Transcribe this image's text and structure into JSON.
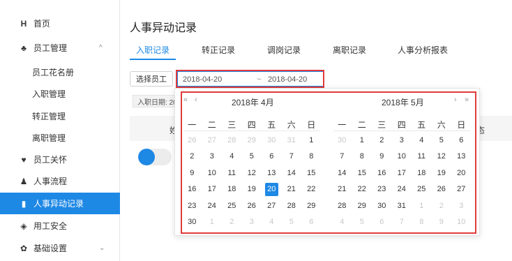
{
  "sidebar": {
    "items": [
      {
        "icon": "home-icon",
        "label": "首页",
        "glyph": "H"
      },
      {
        "icon": "users-icon",
        "label": "员工管理",
        "glyph": "♣",
        "arrow": "^"
      },
      {
        "label": "员工花名册"
      },
      {
        "label": "入职管理"
      },
      {
        "label": "转正管理"
      },
      {
        "label": "离职管理"
      },
      {
        "icon": "heart-icon",
        "label": "员工关怀",
        "glyph": "♥"
      },
      {
        "icon": "user-icon",
        "label": "人事流程",
        "glyph": "♟"
      },
      {
        "icon": "document-icon",
        "label": "人事异动记录",
        "glyph": "▮"
      },
      {
        "icon": "shield-icon",
        "label": "用工安全",
        "glyph": "◈"
      },
      {
        "icon": "gear-icon",
        "label": "基础设置",
        "glyph": "✿",
        "arrow": "⌄"
      }
    ]
  },
  "page": {
    "title": "人事异动记录"
  },
  "tabs": [
    "入职记录",
    "转正记录",
    "调岗记录",
    "离职记录",
    "人事分析报表"
  ],
  "filters": {
    "select_employee": "选择员工",
    "start_date": "2018-04-20",
    "separator": "~",
    "end_date": "2018-04-20",
    "entry_tag": "入职日期: 20"
  },
  "table": {
    "col_name": "姓",
    "col_right": "态"
  },
  "calendar": {
    "nav_prev_year": "«",
    "nav_prev_month": "‹",
    "nav_next_month": "›",
    "nav_next_year": "»",
    "weekdays": [
      "一",
      "二",
      "三",
      "四",
      "五",
      "六",
      "日"
    ],
    "left": {
      "title": "2018年 4月",
      "days": [
        [
          "26",
          "m"
        ],
        [
          "27",
          "m"
        ],
        [
          "28",
          "m"
        ],
        [
          "29",
          "m"
        ],
        [
          "30",
          "m"
        ],
        [
          "31",
          "m"
        ],
        [
          "1",
          ""
        ],
        [
          "2",
          ""
        ],
        [
          "3",
          ""
        ],
        [
          "4",
          ""
        ],
        [
          "5",
          ""
        ],
        [
          "6",
          ""
        ],
        [
          "7",
          ""
        ],
        [
          "8",
          ""
        ],
        [
          "9",
          ""
        ],
        [
          "10",
          ""
        ],
        [
          "11",
          ""
        ],
        [
          "12",
          ""
        ],
        [
          "13",
          ""
        ],
        [
          "14",
          ""
        ],
        [
          "15",
          ""
        ],
        [
          "16",
          ""
        ],
        [
          "17",
          ""
        ],
        [
          "18",
          ""
        ],
        [
          "19",
          ""
        ],
        [
          "20",
          "sel"
        ],
        [
          "21",
          ""
        ],
        [
          "22",
          ""
        ],
        [
          "23",
          ""
        ],
        [
          "24",
          ""
        ],
        [
          "25",
          ""
        ],
        [
          "26",
          ""
        ],
        [
          "27",
          ""
        ],
        [
          "28",
          ""
        ],
        [
          "29",
          ""
        ],
        [
          "30",
          ""
        ],
        [
          "1",
          "m"
        ],
        [
          "2",
          "m"
        ],
        [
          "3",
          "m"
        ],
        [
          "4",
          "m"
        ],
        [
          "5",
          "m"
        ],
        [
          "6",
          "m"
        ]
      ]
    },
    "right": {
      "title": "2018年 5月",
      "days": [
        [
          "30",
          "m"
        ],
        [
          "1",
          ""
        ],
        [
          "2",
          ""
        ],
        [
          "3",
          ""
        ],
        [
          "4",
          ""
        ],
        [
          "5",
          ""
        ],
        [
          "6",
          ""
        ],
        [
          "7",
          ""
        ],
        [
          "8",
          ""
        ],
        [
          "9",
          ""
        ],
        [
          "10",
          ""
        ],
        [
          "11",
          ""
        ],
        [
          "12",
          ""
        ],
        [
          "13",
          ""
        ],
        [
          "14",
          ""
        ],
        [
          "15",
          ""
        ],
        [
          "16",
          ""
        ],
        [
          "17",
          ""
        ],
        [
          "18",
          ""
        ],
        [
          "19",
          ""
        ],
        [
          "20",
          ""
        ],
        [
          "21",
          ""
        ],
        [
          "22",
          ""
        ],
        [
          "23",
          ""
        ],
        [
          "24",
          ""
        ],
        [
          "25",
          ""
        ],
        [
          "26",
          ""
        ],
        [
          "27",
          ""
        ],
        [
          "28",
          ""
        ],
        [
          "29",
          ""
        ],
        [
          "30",
          ""
        ],
        [
          "31",
          ""
        ],
        [
          "1",
          "m"
        ],
        [
          "2",
          "m"
        ],
        [
          "3",
          "m"
        ],
        [
          "4",
          "m"
        ],
        [
          "5",
          "m"
        ],
        [
          "6",
          "m"
        ],
        [
          "7",
          "m"
        ],
        [
          "8",
          "m"
        ],
        [
          "9",
          "m"
        ],
        [
          "10",
          "m"
        ]
      ]
    }
  },
  "colors": {
    "accent": "#1e88e5",
    "highlight": "#e03b3b"
  }
}
